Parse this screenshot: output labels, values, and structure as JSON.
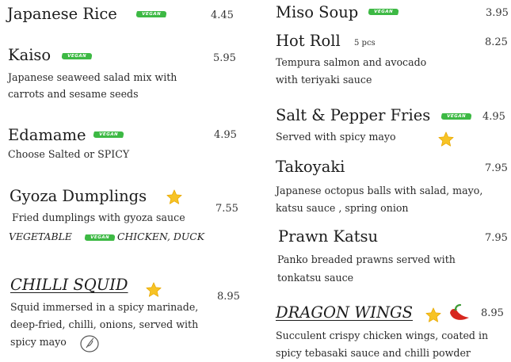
{
  "tags": {
    "vegan": "VEGAN"
  },
  "left": {
    "rice": {
      "name": "Japanese Rice",
      "price": "4.45"
    },
    "kaiso": {
      "name": "Kaiso",
      "price": "5.95",
      "desc1": "Japanese seaweed salad mix with",
      "desc2": "carrots and sesame seeds"
    },
    "edamame": {
      "name": "Edamame",
      "price": "4.95",
      "desc1": "Choose Salted or SPICY"
    },
    "gyoza": {
      "name": "Gyoza Dumplings",
      "price": "7.55",
      "desc1": "Fried dumplings with gyoza sauce",
      "opt_vegetable": "VEGETABLE",
      "opt_chicken": "CHICKEN, DUCK"
    },
    "squid": {
      "name": "CHILLI SQUID",
      "price": "8.95",
      "desc1": "Squid immersed in a spicy marinade,",
      "desc2": "deep-fried,  chilli, onions, served with",
      "desc3": "spicy mayo"
    }
  },
  "right": {
    "miso": {
      "name": "Miso Soup",
      "price": "3.95"
    },
    "hotroll": {
      "name": "Hot Roll",
      "pcs": "5 pcs",
      "price": "8.25",
      "desc1": "Tempura salmon and avocado",
      "desc2": "with teriyaki sauce"
    },
    "fries": {
      "name": "Salt & Pepper Fries",
      "price": "4.95",
      "desc1": "Served with  spicy mayo"
    },
    "takoyaki": {
      "name": "Takoyaki",
      "price": "7.95",
      "desc1": "Japanese octopus  balls with salad, mayo,",
      "desc2": "katsu sauce ,  spring onion"
    },
    "katsu": {
      "name": "Prawn Katsu",
      "price": "7.95",
      "desc1": "Panko breaded prawns served with",
      "desc2": "tonkatsu sauce"
    },
    "wings": {
      "name": "DRAGON WINGS",
      "price": "8.95",
      "desc1": "Succulent crispy chicken wings, coated in",
      "desc2": "spicy tebasaki sauce and  chilli powder"
    }
  },
  "icons": [
    "star-icon",
    "chili-pepper-icon",
    "spicy-mayo-icon"
  ],
  "colors": {
    "vegan_badge": "#3db944",
    "star": "#f7c325",
    "chili": "#d7261e"
  }
}
